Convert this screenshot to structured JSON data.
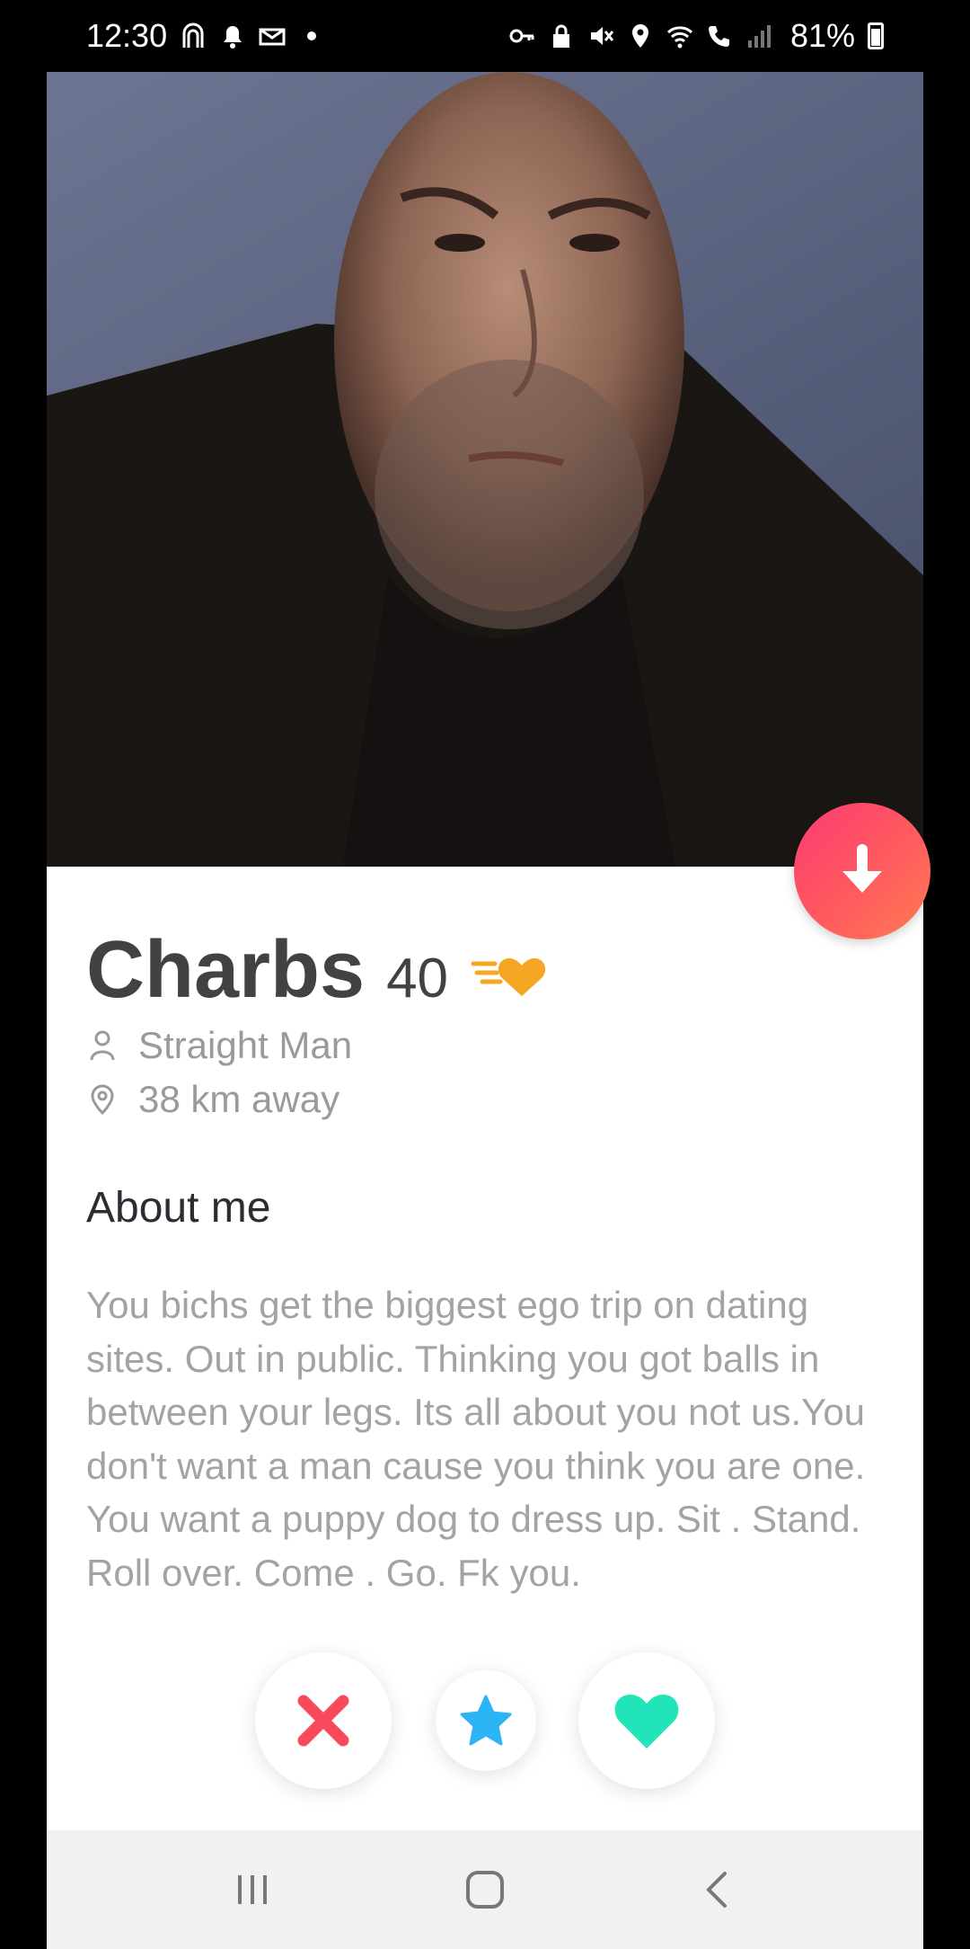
{
  "status_bar": {
    "time": "12:30",
    "battery": "81%",
    "icons": [
      "app-icon",
      "bell-icon",
      "mail-icon",
      "dot-icon",
      "key-icon",
      "lock-icon",
      "mute-icon",
      "location-icon",
      "wifi-icon",
      "call-icon",
      "signal-icon",
      "battery-icon"
    ]
  },
  "profile": {
    "name": "Charbs",
    "age": "40",
    "gender": "Straight Man",
    "distance": "38 km away",
    "about_title": "About me",
    "about_text": "You bichs get the biggest ego trip on dating sites. Out in public. Thinking you got balls in between your legs. Its all about you not us.You don't want a man cause you think you are one. You want a puppy dog to dress up. Sit . Stand. Roll over. Come . Go. Fk you."
  },
  "actions": {
    "collapse": "arrow-down-icon",
    "nope": "close-icon",
    "super_like": "star-icon",
    "like": "heart-icon"
  },
  "colors": {
    "brand_gradient_start": "#fd3a73",
    "brand_gradient_end": "#ff7a52",
    "nope": "#f74a5c",
    "star": "#2db4f5",
    "like": "#21e5b8",
    "badge": "#f5a623"
  },
  "nav": {
    "recents": "recents-icon",
    "home": "home-icon",
    "back": "back-icon"
  }
}
